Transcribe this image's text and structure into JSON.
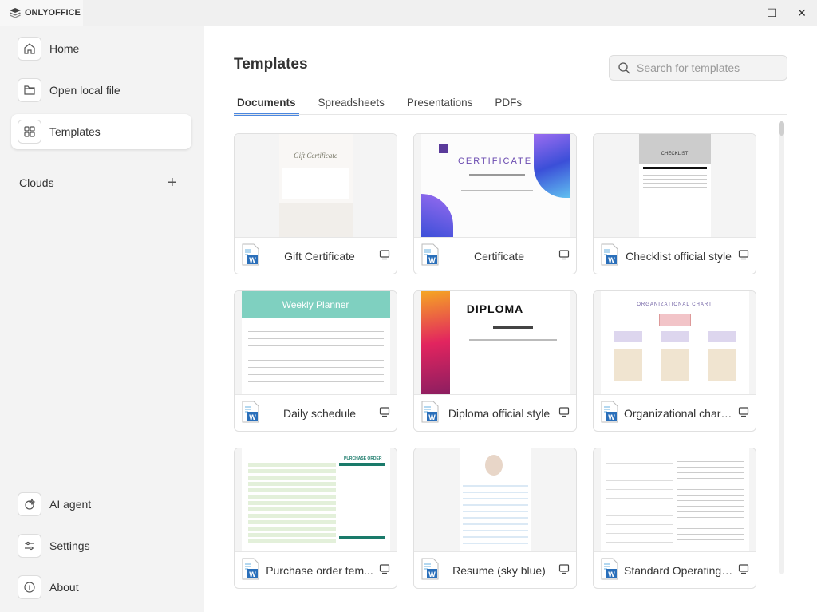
{
  "app": {
    "name": "ONLYOFFICE"
  },
  "window": {
    "minimize": "—",
    "maximize": "☐",
    "close": "✕"
  },
  "sidebar": {
    "items": [
      {
        "label": "Home"
      },
      {
        "label": "Open local file"
      },
      {
        "label": "Templates"
      }
    ],
    "clouds_label": "Clouds",
    "add_label": "+",
    "bottom_items": [
      {
        "label": "AI agent"
      },
      {
        "label": "Settings"
      },
      {
        "label": "About"
      }
    ]
  },
  "main": {
    "title": "Templates",
    "search": {
      "placeholder": "Search for templates",
      "value": ""
    },
    "tabs": [
      {
        "label": "Documents",
        "active": true
      },
      {
        "label": "Spreadsheets"
      },
      {
        "label": "Presentations"
      },
      {
        "label": "PDFs"
      }
    ],
    "templates": [
      {
        "name": "Gift Certificate",
        "thumb_text": "Gift Certificate"
      },
      {
        "name": "Certificate",
        "thumb_text": "CERTIFICATE"
      },
      {
        "name": "Checklist official style",
        "thumb_text": "CHECKLIST"
      },
      {
        "name": "Daily schedule",
        "thumb_text": "Weekly Planner"
      },
      {
        "name": "Diploma official style",
        "thumb_text": "DIPLOMA"
      },
      {
        "name": "Organizational chart ...",
        "thumb_text": "ORGANIZATIONAL CHART"
      },
      {
        "name": "Purchase order tem...",
        "thumb_text": "PURCHASE ORDER"
      },
      {
        "name": "Resume (sky blue)",
        "thumb_text": ""
      },
      {
        "name": "Standard Operating ...",
        "thumb_text": ""
      }
    ]
  },
  "colors": {
    "accent": "#4a87e0",
    "word": "#2a6fba"
  }
}
